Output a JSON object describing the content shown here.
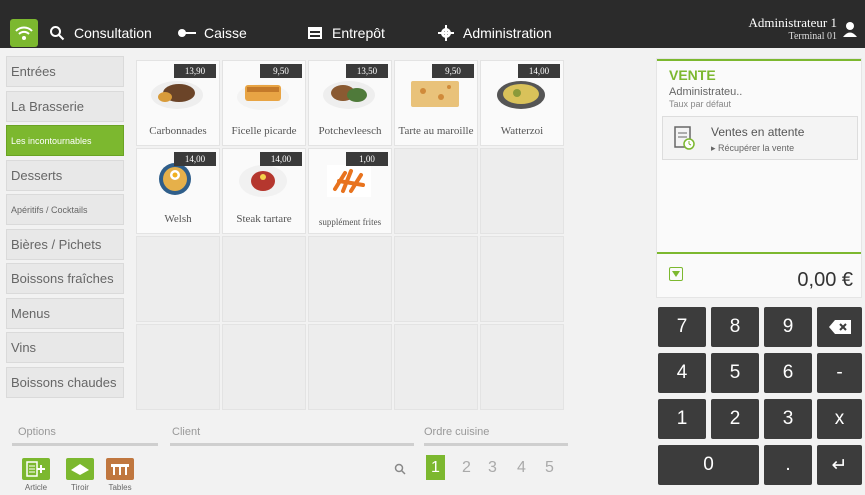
{
  "topbar": {
    "nav": [
      {
        "label": "Consultation",
        "icon": "search-icon"
      },
      {
        "label": "Caisse",
        "icon": "key-icon"
      },
      {
        "label": "Entrepôt",
        "icon": "warehouse-icon"
      },
      {
        "label": "Administration",
        "icon": "gear-icon"
      }
    ],
    "user_name": "Administrateur 1",
    "terminal": "Terminal 01"
  },
  "categories": [
    "Entrées",
    "La Brasserie",
    "Les incontournables",
    "Desserts",
    "Apéritifs / Cocktails",
    "Bières / Pichets",
    "Boissons fraîches",
    "Menus",
    "Vins",
    "Boissons chaudes"
  ],
  "active_category": "Les incontournables",
  "products": [
    {
      "name": "Carbonnades",
      "price": "13,90"
    },
    {
      "name": "Ficelle picarde",
      "price": "9,50"
    },
    {
      "name": "Potchevleesch",
      "price": "13,50"
    },
    {
      "name": "Tarte au maroille",
      "price": "9,50"
    },
    {
      "name": "Watterzoi",
      "price": "14,00"
    },
    {
      "name": "Welsh",
      "price": "14,00"
    },
    {
      "name": "Steak tartare",
      "price": "14,00"
    },
    {
      "name": "supplément frites",
      "price": "1,00"
    }
  ],
  "bottom": {
    "options_label": "Options",
    "client_label": "Client",
    "order_label": "Ordre cuisine",
    "options": [
      "Article",
      "Tiroir",
      "Tables"
    ],
    "order_numbers": [
      "1",
      "2",
      "3",
      "4",
      "5"
    ]
  },
  "sale": {
    "title": "VENTE",
    "user": "Administrateu..",
    "rate": "Taux par défaut",
    "pending_title": "Ventes en attente",
    "pending_sub": "Récupérer la vente",
    "total": "0,00 €"
  },
  "keypad": {
    "keys": [
      "7",
      "8",
      "9",
      "4",
      "5",
      "6",
      "-",
      "1",
      "2",
      "3",
      "x",
      "0",
      ".",
      "↵"
    ]
  },
  "colors": {
    "accent": "#7cb82f",
    "dark": "#2b2b2b"
  }
}
